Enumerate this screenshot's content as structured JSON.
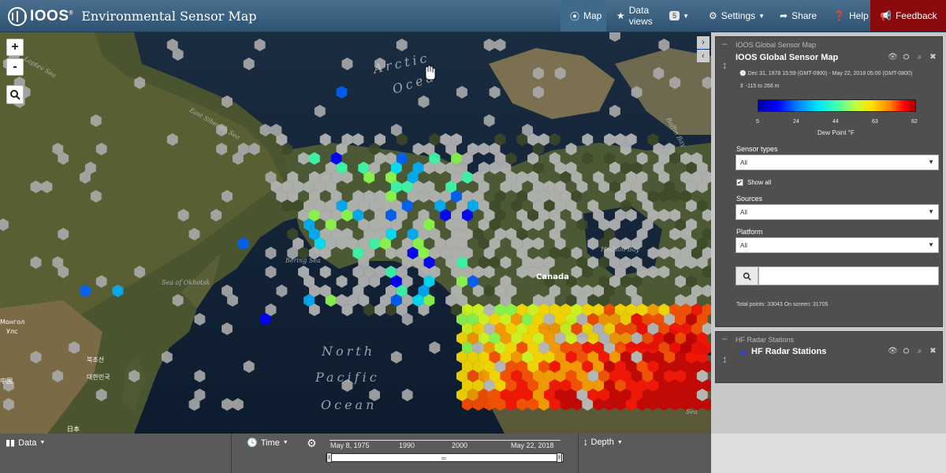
{
  "app": {
    "logo_text": "IOOS",
    "logo_superscript": "®",
    "title": "Environmental Sensor Map"
  },
  "nav": {
    "map": "Map",
    "data_views": "Data views",
    "data_views_count": "5",
    "settings": "Settings",
    "share": "Share",
    "help": "Help",
    "feedback": "Feedback"
  },
  "map": {
    "zoom_in": "+",
    "zoom_out": "-",
    "labels": {
      "arctic": "Arctic",
      "ocean_arctic": "Ocea",
      "canada": "Canada",
      "north": "North",
      "pacific": "Pacific",
      "ocean": "Ocean",
      "laptev_sea": "Laptev Sea",
      "east_siberian_sea": "East Siberian Sea",
      "bering_sea": "Bering Sea",
      "sea_of_okhotsk": "Sea of Okhotsk",
      "hudson_bay": "Hudson Bay",
      "baffin_bay": "Baffin Bay",
      "mongolia": "Монгол",
      "ulaanbaatar": "Улс",
      "north_korea": "북조선",
      "south_korea": "대한민국",
      "china": "中国",
      "japan": "日本",
      "sea_small": "Sea"
    }
  },
  "sensor_panel": {
    "header": "IOOS Global Sensor Map",
    "title": "IOOS Global Sensor Map",
    "time_range": "Dec 31, 1978 15:59 (GMT-0900) - May 22, 2018 05:00 (GMT-0800)",
    "depth_range": "-115 to 266 m",
    "scale_ticks": [
      "5",
      "24",
      "44",
      "63",
      "82"
    ],
    "scale_label": "Dew Point °F",
    "sensor_types_label": "Sensor types",
    "sensor_types_value": "All",
    "show_all_label": "Show all",
    "show_all_checked": true,
    "sources_label": "Sources",
    "sources_value": "All",
    "platform_label": "Platform",
    "platform_value": "All",
    "search_value": "",
    "total_points": "Total points: 33043 On screen: 31705"
  },
  "radar_panel": {
    "header": "HF Radar Stations",
    "title": "HF Radar Stations",
    "dot_color": "#2040ff"
  },
  "bottombar": {
    "data": "Data",
    "time": "Time",
    "depth": "Depth",
    "timeline": {
      "start": "May 8, 1975",
      "tick1": "1990",
      "tick2": "2000",
      "end": "May 22, 2018"
    }
  },
  "colors": {
    "navbar": "#3a5f80",
    "feedback": "#8a0b0b",
    "panel": "#4f4f4f",
    "sidebar_bg": "#c8c8c8"
  }
}
